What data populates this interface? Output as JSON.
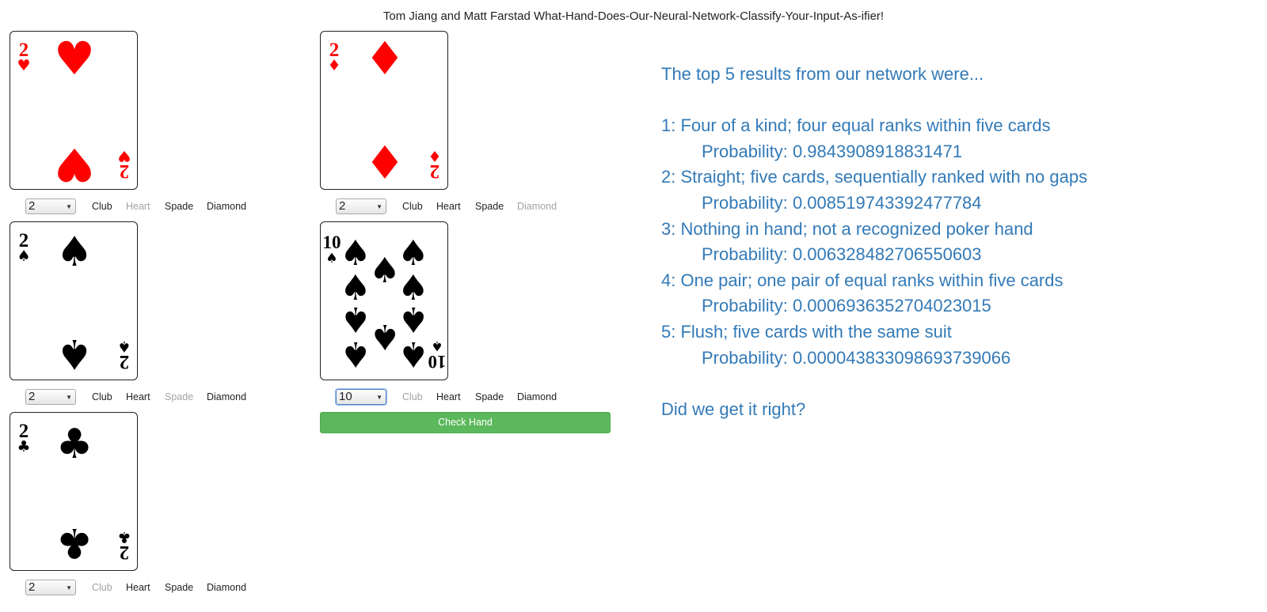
{
  "page": {
    "title": "Tom Jiang and Matt Farstad What-Hand-Does-Our-Neural-Network-Classify-Your-Input-As-ifier!"
  },
  "cards": [
    {
      "rank": "2",
      "suit": "heart",
      "color": "#ff0000",
      "selected": "2",
      "muted_suit": "Heart"
    },
    {
      "rank": "2",
      "suit": "diamond",
      "color": "#ff0000",
      "selected": "2",
      "muted_suit": "Diamond"
    },
    {
      "rank": "2",
      "suit": "spade",
      "color": "#000000",
      "selected": "2",
      "muted_suit": "Spade"
    },
    {
      "rank": "10",
      "suit": "spade",
      "color": "#000000",
      "selected": "10",
      "muted_suit": "Club"
    },
    {
      "rank": "2",
      "suit": "club",
      "color": "#000000",
      "selected": "2",
      "muted_suit": "Club"
    }
  ],
  "suit_labels": {
    "club": "Club",
    "heart": "Heart",
    "spade": "Spade",
    "diamond": "Diamond"
  },
  "check_button": {
    "label": "Check Hand",
    "color": "#5cb85c"
  },
  "results": {
    "heading": "The top 5 results from our network were...",
    "items": [
      {
        "label": "1: Four of a kind; four equal ranks within five cards",
        "probability": "Probability: 0.9843908918831471"
      },
      {
        "label": "2: Straight; five cards, sequentially ranked with no gaps",
        "probability": "Probability: 0.008519743392477784"
      },
      {
        "label": "3: Nothing in hand; not a recognized poker hand",
        "probability": "Probability: 0.006328482706550603"
      },
      {
        "label": "4: One pair; one pair of equal ranks within five cards",
        "probability": "Probability: 0.0006936352704023015"
      },
      {
        "label": "5: Flush; five cards with the same suit",
        "probability": "Probability: 0.000043833098693739066"
      }
    ],
    "question": "Did we get it right?",
    "color": "#337ab7"
  }
}
